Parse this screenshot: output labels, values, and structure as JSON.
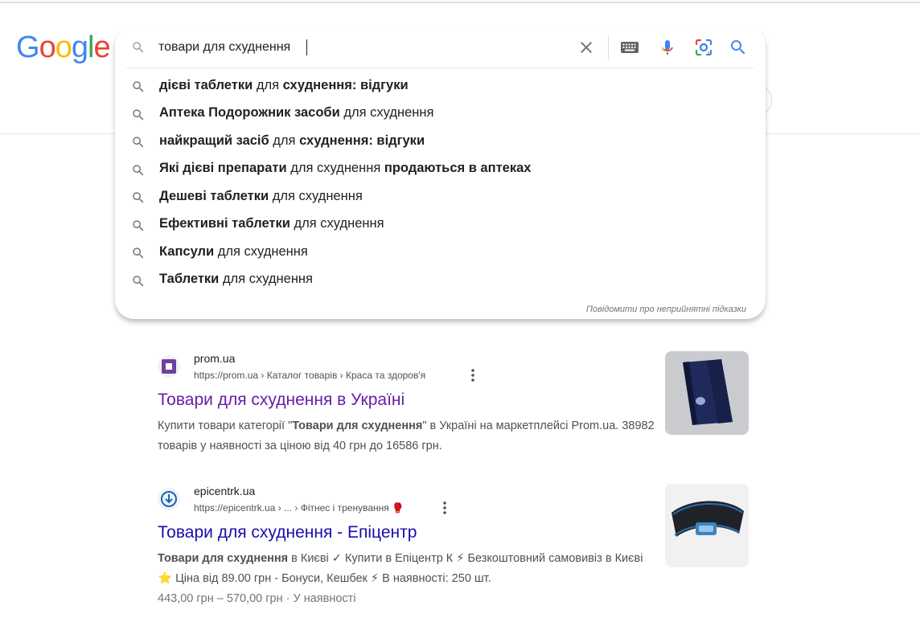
{
  "colors": {
    "google_blue": "#4285F4",
    "google_red": "#EA4335",
    "google_yellow": "#FBBC05",
    "google_green": "#34A853",
    "link_visited": "#681da8",
    "link": "#1a0dab",
    "icon_gray": "#70757a"
  },
  "logo": {
    "letters": [
      "G",
      "o",
      "o",
      "g",
      "l",
      "e"
    ]
  },
  "search": {
    "query": "товари для схуднення",
    "icons": [
      "search-icon",
      "clear-icon",
      "keyboard-icon",
      "microphone-icon",
      "lens-icon",
      "search-submit-icon"
    ]
  },
  "suggestions": [
    {
      "parts": [
        {
          "t": "дієві таблетки",
          "b": true
        },
        {
          "t": " для ",
          "b": false
        },
        {
          "t": "схуднення: відгуки",
          "b": true
        }
      ]
    },
    {
      "parts": [
        {
          "t": "Аптека Подорожник засоби",
          "b": true
        },
        {
          "t": " для схуднення",
          "b": false
        }
      ]
    },
    {
      "parts": [
        {
          "t": "найкращий засіб",
          "b": true
        },
        {
          "t": " для ",
          "b": false
        },
        {
          "t": "схуднення: відгуки",
          "b": true
        }
      ]
    },
    {
      "parts": [
        {
          "t": "Які дієві препарати",
          "b": true
        },
        {
          "t": " для схуднення ",
          "b": false
        },
        {
          "t": "продаються в аптеках",
          "b": true
        }
      ]
    },
    {
      "parts": [
        {
          "t": "Дешеві таблетки",
          "b": true
        },
        {
          "t": " для схуднення",
          "b": false
        }
      ]
    },
    {
      "parts": [
        {
          "t": "Ефективні таблетки",
          "b": true
        },
        {
          "t": " для схуднення",
          "b": false
        }
      ]
    },
    {
      "parts": [
        {
          "t": "Капсули",
          "b": true
        },
        {
          "t": " для схуднення",
          "b": false
        }
      ]
    },
    {
      "parts": [
        {
          "t": "Таблетки",
          "b": true
        },
        {
          "t": " для схуднення",
          "b": false
        }
      ]
    }
  ],
  "report_text": "Повідомити про неприйнятні підказки",
  "results": [
    {
      "site_name": "prom.ua",
      "url": "https://prom.ua › Каталог товарів › Краса та здоров'я",
      "title": "Товари для схуднення в Україні",
      "title_color": "#681da8",
      "snippet_parts": [
        {
          "t": "Купити товари категорії \"",
          "b": false
        },
        {
          "t": "Товари для схуднення",
          "b": true
        },
        {
          "t": "\" в Україні на маркетплейсі Prom.ua. 38982 товарів у наявності за ціною від 40 грн до 16586 грн.",
          "b": false
        }
      ],
      "price_line": ""
    },
    {
      "site_name": "epicentrk.ua",
      "url": "https://epicentrk.ua › ... › Фітнес і тренування 🥊",
      "title": "Товари для схуднення - Епіцентр",
      "title_color": "#1a0dab",
      "snippet_parts": [
        {
          "t": "Товари для схуднення",
          "b": true
        },
        {
          "t": " в Києві ✓ Купити в Епіцентр К ⚡ Безкоштовний самовивіз в Києві ⭐ Ціна від 89.00 грн - Бонуси, Кешбек ⚡ В наявності: 250 шт.",
          "b": false
        }
      ],
      "price_line": "443,00 грн – 570,00 грн · У наявності"
    }
  ]
}
